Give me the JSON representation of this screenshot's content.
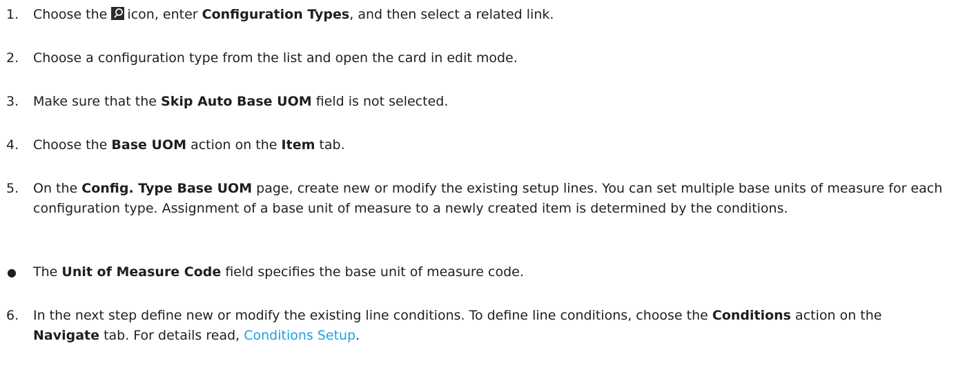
{
  "steps": [
    {
      "num": "1.",
      "a": "Choose the",
      "b": "icon, enter",
      "c": "Configuration Types",
      "d": ", and then select a related link."
    },
    {
      "num": "2.",
      "a": "Choose a configuration type from the list and open the card in edit mode."
    },
    {
      "num": "3.",
      "a": "Make sure that the",
      "b": "Skip Auto Base UOM",
      "c": "field is not selected."
    },
    {
      "num": "4.",
      "a": "Choose the",
      "b": "Base UOM",
      "c": "action on the",
      "d": "Item",
      "e": "tab."
    },
    {
      "num": "5.",
      "a": "On the",
      "b": "Config. Type Base UOM",
      "c": "page, create new or modify the existing setup lines. You can set multiple base units of measure for each configuration type. Assignment of a base unit of measure to a newly created item is determined by the conditions."
    },
    {
      "num": "6.",
      "a": "In the next step define new or modify the existing line conditions. To define line conditions, choose the",
      "b": "Conditions",
      "c": "action on the",
      "d": "Navigate",
      "e": "tab. For details read,",
      "f": "Conditions Setup",
      "g": "."
    }
  ],
  "bullet": {
    "symbol": "●",
    "a": "The",
    "b": "Unit of Measure Code",
    "c": "field specifies the base unit of measure code."
  },
  "icons": {
    "search": "search-icon"
  },
  "colors": {
    "link": "#1ba1e2",
    "text": "#1e1e1e"
  }
}
